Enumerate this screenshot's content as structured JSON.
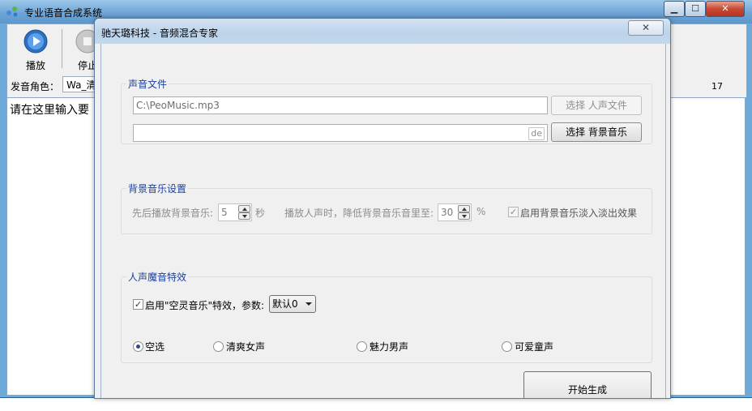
{
  "main_window": {
    "title": "专业语音合成系统",
    "window_controls": {
      "minimize": "▁",
      "maximize": "☐",
      "close": "✕"
    },
    "toolbar": {
      "play_label": "播放",
      "stop_label": "停止"
    },
    "voice_label": "发音角色：",
    "voice_value": "Wa_清",
    "counter": "17",
    "text_placeholder": "请在这里输入要"
  },
  "dialog": {
    "title": "驰天璐科技 - 音频混合专家",
    "close_glyph": "✕",
    "sound_files": {
      "title": "声音文件",
      "voice_file_value": "C:\\PeoMusic.mp3",
      "select_voice_label": "选择 人声文件",
      "bg_music_value": "",
      "bg_tag": "de",
      "select_bg_label": "选择 背景音乐"
    },
    "bg_settings": {
      "title": "背景音乐设置",
      "delay_label": "先后播放背景音乐:",
      "delay_value": "5",
      "delay_unit": "秒",
      "reduce_label": "播放人声时，降低背景音乐音里至:",
      "reduce_value": "30",
      "reduce_unit": "%",
      "fade_checked": true,
      "fade_label": "启用背景音乐淡入淡出效果"
    },
    "effects": {
      "title": "人声魔音特效",
      "enable_checked": true,
      "enable_label": "启用\"空灵音乐\"特效，参数:",
      "param_value": "默认0",
      "radios": [
        {
          "label": "空选",
          "selected": true
        },
        {
          "label": "清爽女声",
          "selected": false
        },
        {
          "label": "魅力男声",
          "selected": false
        },
        {
          "label": "可爱童声",
          "selected": false
        }
      ]
    },
    "start_label": "开始生成"
  },
  "colors": {
    "accent_blue": "#1a3f9e",
    "titlebar_blue": "#6fa5d6",
    "close_red": "#c84a33"
  }
}
